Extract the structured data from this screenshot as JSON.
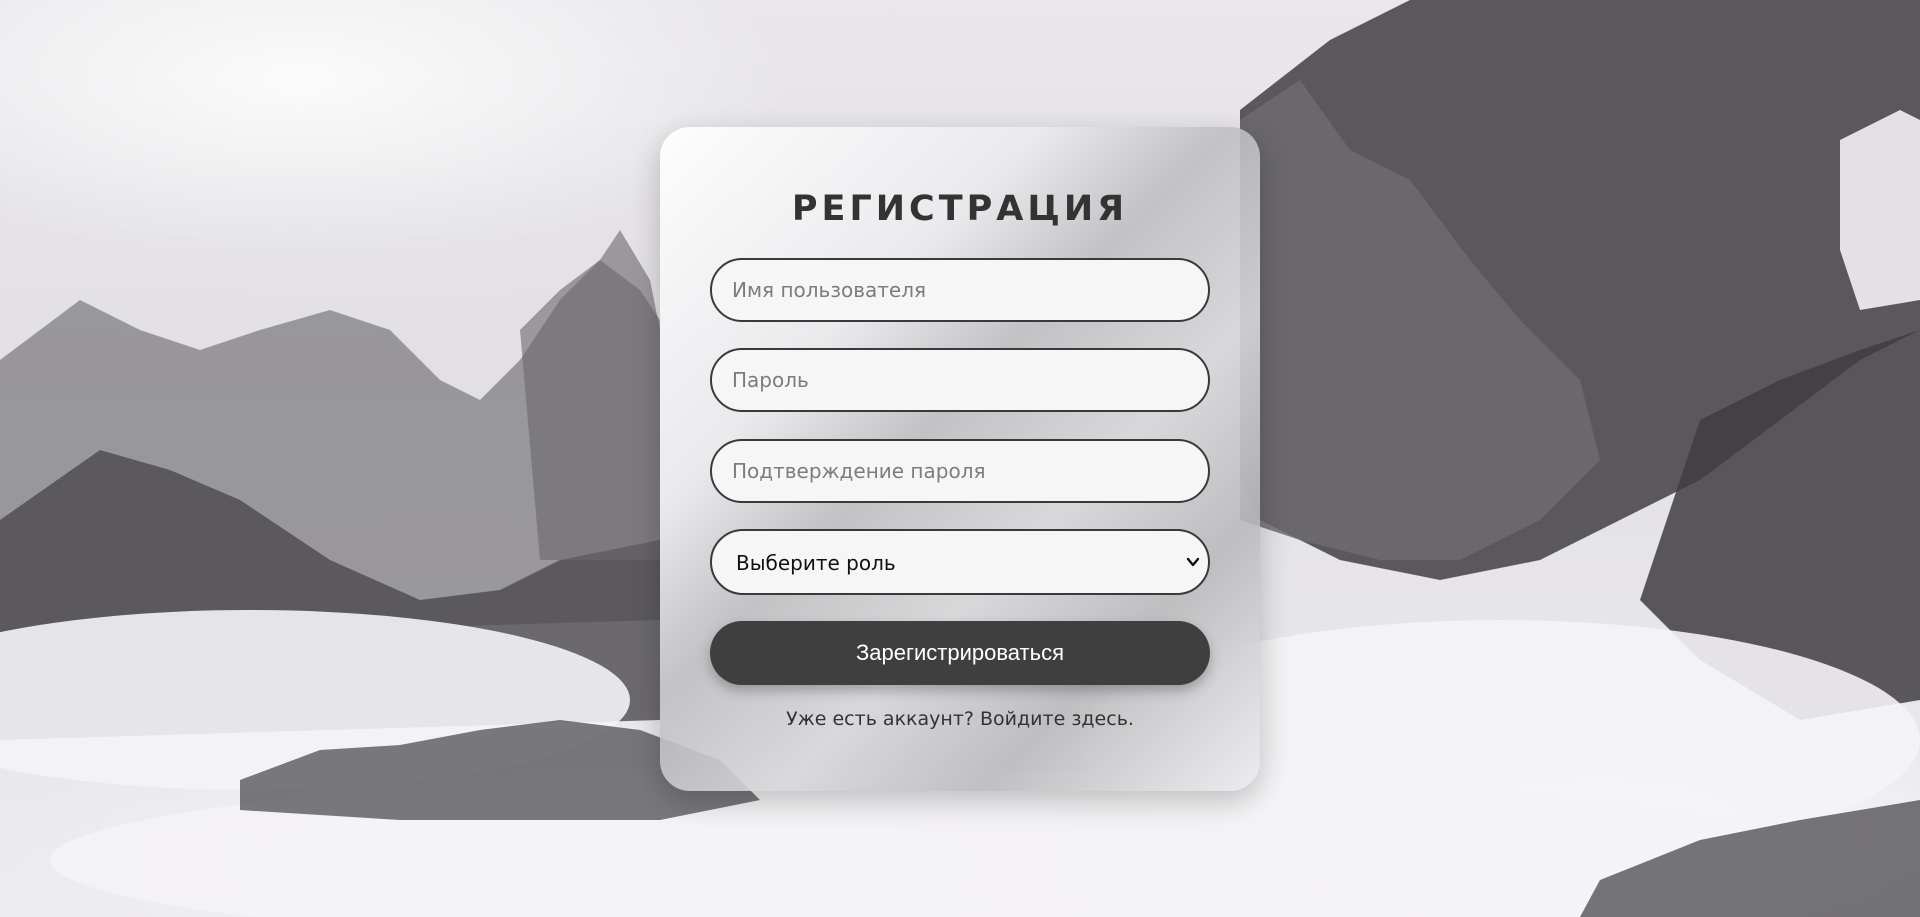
{
  "form": {
    "title": "РЕГИСТРАЦИЯ",
    "username_placeholder": "Имя пользователя",
    "password_placeholder": "Пароль",
    "confirm_placeholder": "Подтверждение пароля",
    "role_select_value": "Выберите роль",
    "submit_label": "Зарегистрироваться",
    "login_link_text": "Уже есть аккаунт? Войдите здесь."
  },
  "colors": {
    "button_bg": "#3f3f3f",
    "field_border": "#3a3a3a",
    "title": "#333333"
  }
}
